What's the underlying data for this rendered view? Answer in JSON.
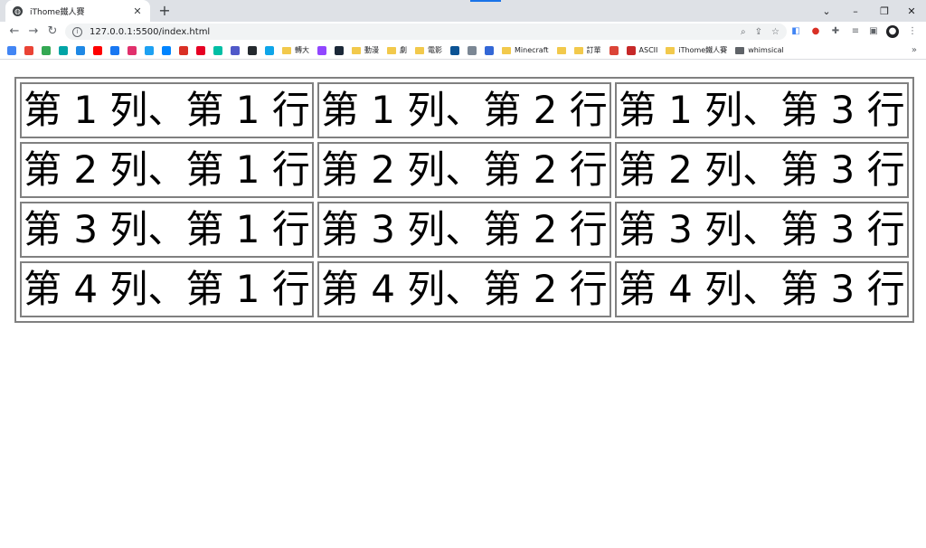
{
  "browser": {
    "tab_title": "iThome鐵人賽",
    "tab_close": "✕",
    "new_tab": "+",
    "url": "127.0.0.1:5500/index.html",
    "window_controls": [
      "⌄",
      "–",
      "❐",
      "✕"
    ],
    "bookmarks": [
      {
        "type": "icon",
        "color": "#4285f4",
        "icon": "drive-icon"
      },
      {
        "type": "icon",
        "color": "#ea4335",
        "icon": "gmail-icon"
      },
      {
        "type": "icon",
        "color": "#34a853",
        "icon": "photos-icon"
      },
      {
        "type": "icon",
        "color": "#00a4a6",
        "icon": "tv-icon"
      },
      {
        "type": "icon",
        "color": "#1e88e5",
        "icon": "app-icon"
      },
      {
        "type": "icon",
        "color": "#ff0000",
        "icon": "youtube-icon"
      },
      {
        "type": "icon",
        "color": "#1877f2",
        "icon": "facebook-icon"
      },
      {
        "type": "icon",
        "color": "#e1306c",
        "icon": "instagram-icon"
      },
      {
        "type": "icon",
        "color": "#1da1f2",
        "icon": "twitter-icon"
      },
      {
        "type": "icon",
        "color": "#0084ff",
        "icon": "messenger-icon"
      },
      {
        "type": "icon",
        "color": "#d93025",
        "icon": "news-icon"
      },
      {
        "type": "icon",
        "color": "#e60023",
        "icon": "pinterest-icon"
      },
      {
        "type": "icon",
        "color": "#00bfa5",
        "icon": "tool-icon"
      },
      {
        "type": "icon",
        "color": "#5059c9",
        "icon": "teams-icon"
      },
      {
        "type": "icon",
        "color": "#24292e",
        "icon": "github-icon"
      },
      {
        "type": "icon",
        "color": "#0ea5e9",
        "icon": "chatgpt-icon"
      },
      {
        "type": "folder",
        "label": "轉大"
      },
      {
        "type": "icon",
        "color": "#9146ff",
        "icon": "twitch-icon"
      },
      {
        "type": "icon",
        "color": "#1b2838",
        "icon": "steam-icon"
      },
      {
        "type": "folder",
        "label": "動漫"
      },
      {
        "type": "folder",
        "label": "劇"
      },
      {
        "type": "folder",
        "label": "電影"
      },
      {
        "type": "icon",
        "color": "#0b5394",
        "icon": "site-icon"
      },
      {
        "type": "icon",
        "color": "#7b8794",
        "icon": "site2-icon"
      },
      {
        "type": "icon",
        "color": "#3367d6",
        "icon": "k-icon"
      },
      {
        "type": "folder",
        "label": "Minecraft"
      },
      {
        "type": "folder",
        "label": ""
      },
      {
        "type": "folder",
        "label": "訂單"
      },
      {
        "type": "icon",
        "color": "#db4437",
        "icon": "shop-icon"
      },
      {
        "type": "icon-label",
        "color": "#c62828",
        "icon": "r-icon",
        "label": "ASCII"
      },
      {
        "type": "folder",
        "label": "iThome鐵人賽"
      },
      {
        "type": "folder-dark",
        "label": "whimsical"
      }
    ]
  },
  "table": {
    "rows": [
      [
        "第 1 列、第 1 行",
        "第 1 列、第 2 行",
        "第 1 列、第 3 行"
      ],
      [
        "第 2 列、第 1 行",
        "第 2 列、第 2 行",
        "第 2 列、第 3 行"
      ],
      [
        "第 3 列、第 1 行",
        "第 3 列、第 2 行",
        "第 3 列、第 3 行"
      ],
      [
        "第 4 列、第 1 行",
        "第 4 列、第 2 行",
        "第 4 列、第 3 行"
      ]
    ]
  }
}
